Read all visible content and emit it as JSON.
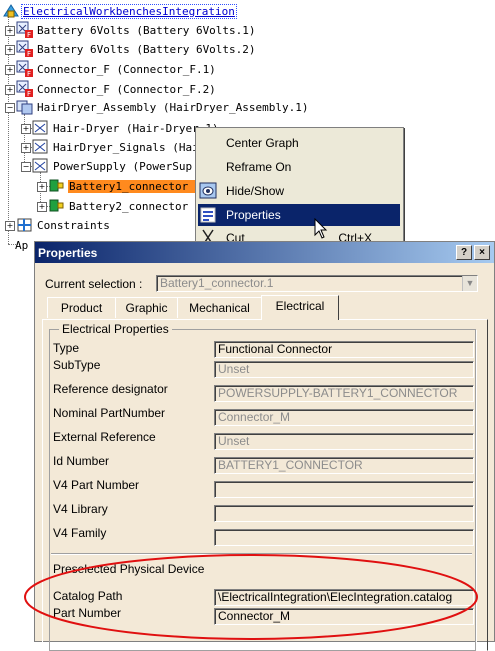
{
  "tree": {
    "root": "ElectricalWorkbenchesIntegration",
    "items": [
      "Battery 6Volts (Battery 6Volts.1)",
      "Battery 6Volts (Battery 6Volts.2)",
      "Connector_F (Connector_F.1)",
      "Connector_F (Connector_F.2)",
      "HairDryer_Assembly (HairDryer_Assembly.1)",
      "Hair-Dryer (Hair-Dryer.1)",
      "HairDryer_Signals (HairD",
      "PowerSupply (PowerSup",
      "Battery1_connector (B",
      "Battery2_connector (B",
      "Constraints",
      "Ap"
    ]
  },
  "context_menu": {
    "items": [
      {
        "label": "Center Graph",
        "icon": ""
      },
      {
        "label": "Reframe On",
        "icon": ""
      },
      {
        "label": "Hide/Show",
        "icon": "hide-show-icon"
      },
      {
        "label": "Properties",
        "icon": "properties-icon"
      },
      {
        "label": "Cut",
        "shortcut": "Ctrl+X",
        "icon": "scissors-icon"
      }
    ],
    "highlighted": "Properties"
  },
  "dialog": {
    "title": "Properties",
    "help_button": "?",
    "close_button": "×",
    "current_selection_label": "Current selection :",
    "current_selection_value": "Battery1_connector.1",
    "tabs": [
      "Product",
      "Graphic",
      "Mechanical",
      "Electrical"
    ],
    "active_tab": "Electrical",
    "group_title": "Electrical Properties",
    "properties": [
      {
        "label": "Type",
        "value": "Functional Connector",
        "enabled": true
      },
      {
        "label": "SubType",
        "value": "Unset",
        "enabled": false
      },
      {
        "label": "Reference designator",
        "value": "POWERSUPPLY-BATTERY1_CONNECTOR",
        "enabled": false
      },
      {
        "label": "Nominal PartNumber",
        "value": "Connector_M",
        "enabled": false
      },
      {
        "label": "External Reference",
        "value": "Unset",
        "enabled": false
      },
      {
        "label": "Id Number",
        "value": "BATTERY1_CONNECTOR",
        "enabled": false
      },
      {
        "label": "V4 Part Number",
        "value": "",
        "enabled": false
      },
      {
        "label": "V4 Library",
        "value": "",
        "enabled": false
      },
      {
        "label": "V4 Family",
        "value": "",
        "enabled": false
      }
    ],
    "physical_device_title": "Preselected Physical Device",
    "catalog_path_label": "Catalog Path",
    "catalog_path_value": "\\ElectricalIntegration\\ElecIntegration.catalog",
    "part_number_label": "Part Number",
    "part_number_value": "Connector_M"
  },
  "colors": {
    "selection_orange": "#ff8a1e",
    "menu_highlight": "#0a246a",
    "dialog_bg": "#f3e9d7",
    "annotation_ellipse": "#e01010"
  }
}
